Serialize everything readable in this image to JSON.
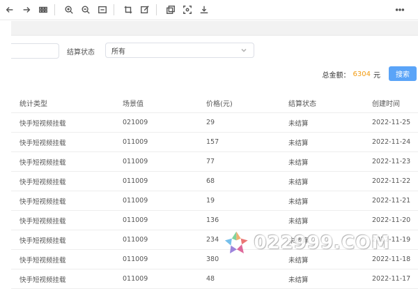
{
  "toolbar": {
    "icons": [
      "back-icon",
      "forward-icon",
      "apps-grid-icon",
      "zoom-in-icon",
      "zoom-out-icon",
      "fit-width-icon",
      "crop-icon",
      "edit-icon",
      "copy-icon",
      "screenshot-icon",
      "download-icon",
      "more-icon"
    ]
  },
  "filter": {
    "settlement_label": "结算状态",
    "settlement_value": "所有"
  },
  "summary": {
    "total_label": "总金额：",
    "total_amount": "6304",
    "currency": "元",
    "search_label": "搜索"
  },
  "table": {
    "headers": [
      "统计类型",
      "场景值",
      "价格(元)",
      "结算状态",
      "创建时间"
    ],
    "rows": [
      [
        "快手短视频挂载",
        "021009",
        "29",
        "未结算",
        "2022-11-25"
      ],
      [
        "快手短视频挂载",
        "011009",
        "157",
        "未结算",
        "2022-11-24"
      ],
      [
        "快手短视频挂载",
        "011009",
        "77",
        "未结算",
        "2022-11-23"
      ],
      [
        "快手短视频挂载",
        "011009",
        "68",
        "未结算",
        "2022-11-22"
      ],
      [
        "快手短视频挂载",
        "011009",
        "19",
        "未结算",
        "2022-11-21"
      ],
      [
        "快手短视频挂载",
        "011009",
        "136",
        "未结算",
        "2022-11-20"
      ],
      [
        "快手短视频挂载",
        "011009",
        "234",
        "未结算",
        "2022-11-19"
      ],
      [
        "快手短视频挂载",
        "011009",
        "380",
        "未结算",
        "2022-11-18"
      ],
      [
        "快手短视频挂载",
        "011009",
        "48",
        "未结算",
        "2022-11-17"
      ]
    ]
  },
  "watermark": {
    "text": "022999.COM"
  }
}
